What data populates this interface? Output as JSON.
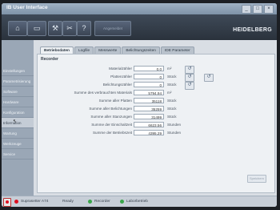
{
  "window": {
    "title": "IB User Interface",
    "controls": [
      "_",
      "□",
      "×"
    ]
  },
  "toolbar": {
    "buttons": [
      {
        "name": "home-button",
        "icon": "home-icon",
        "glyph": "⌂"
      },
      {
        "name": "monitor-button",
        "icon": "monitor-icon",
        "glyph": "▭"
      },
      {
        "name": "tools-button",
        "icon": "wrench-icon",
        "glyph": "⚒"
      },
      {
        "name": "service-button",
        "icon": "tools-icon",
        "glyph": "✂"
      },
      {
        "name": "help-button",
        "icon": "help-icon",
        "glyph": "?"
      }
    ],
    "field_label": "Angemeldet",
    "brand": "HEIDELBERG"
  },
  "sidebar": {
    "items": [
      {
        "label": "Einstellungen",
        "active": false
      },
      {
        "label": "Parametrisierung",
        "active": false
      },
      {
        "label": "Software",
        "active": false
      },
      {
        "label": "Hardware",
        "active": false
      },
      {
        "label": "Konfiguration",
        "active": false
      },
      {
        "label": "Information",
        "active": true
      },
      {
        "label": "Wartung",
        "active": false
      },
      {
        "label": "Werkzeuge",
        "active": false
      },
      {
        "label": "Service",
        "active": false
      }
    ]
  },
  "tabs": [
    {
      "label": "Betriebsdaten",
      "active": true
    },
    {
      "label": "Logfile",
      "active": false
    },
    {
      "label": "Messwerte",
      "active": false
    },
    {
      "label": "Belichtungszeiten",
      "active": false
    },
    {
      "label": "IDE Parameter",
      "active": false
    }
  ],
  "panel": {
    "group_label": "Recorder",
    "rows": [
      {
        "label": "Materialzähler",
        "value": "0.0",
        "unit": "m²",
        "reset": true,
        "reset2": false
      },
      {
        "label": "Plattenzähler",
        "value": "0",
        "unit": "Stück",
        "reset": true,
        "reset2": true
      },
      {
        "label": "Belichtungszähler",
        "value": "0",
        "unit": "Stück",
        "reset": true,
        "reset2": false
      },
      {
        "label": "Summe des verbrauchten Materials",
        "value": "5794.94",
        "unit": "m²",
        "reset": false,
        "reset2": false
      },
      {
        "label": "Summe aller Platten",
        "value": "35118",
        "unit": "Stück",
        "reset": false,
        "reset2": false
      },
      {
        "label": "Summe aller Belichtungen",
        "value": "35259",
        "unit": "Stück",
        "reset": false,
        "reset2": false
      },
      {
        "label": "Summe aller Stanzungen",
        "value": "31499",
        "unit": "Stück",
        "reset": false,
        "reset2": false
      },
      {
        "label": "Summe der Einschaltzeit",
        "value": "6623.56",
        "unit": "Stunden",
        "reset": false,
        "reset2": false
      },
      {
        "label": "Summe der Betriebszeit",
        "value": "4395.29",
        "unit": "Stunden",
        "reset": false,
        "reset2": false
      }
    ],
    "bottom_button": "Speichern"
  },
  "status": {
    "device": "Suprasetter A74",
    "state": "Ready",
    "recorder_label": "Recorder",
    "lab_label": "Laborbetrieb",
    "colors": {
      "recorder": "#3aa64a",
      "lab": "#3aa64a"
    }
  }
}
